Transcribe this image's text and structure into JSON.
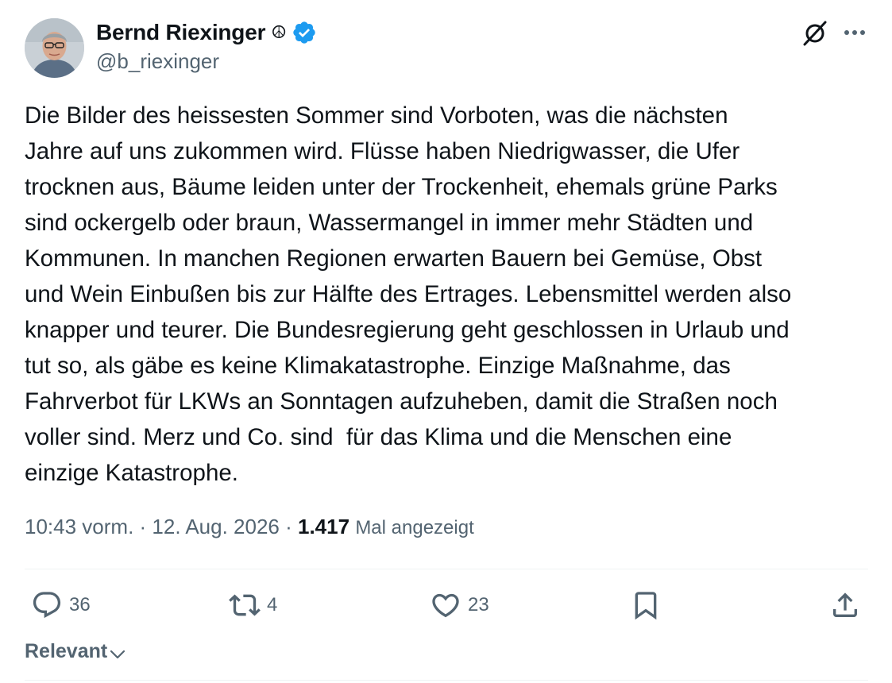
{
  "author": {
    "name": "Bernd Riexinger",
    "name_emoji": "☮",
    "handle": "@b_riexinger",
    "verified_color": "#1d9bf0"
  },
  "tweet": {
    "text": "Die Bilder des heissesten Sommer sind Vorboten, was die nächsten\nJahre auf uns zukommen wird. Flüsse haben Niedrigwasser, die Ufer\ntrocknen aus, Bäume leiden unter der Trockenheit, ehemals grüne Parks\nsind ockergelb oder braun, Wassermangel in immer mehr Städten und\nKommunen. In manchen Regionen erwarten Bauern bei Gemüse, Obst\nund Wein Einbußen bis zur Hälfte des Ertrages. Lebensmittel werden also\nknapper und teurer. Die Bundesregierung geht geschlossen in Urlaub und\ntut so, als gäbe es keine Klimakatastrophe. Einzige Maßnahme, das\nFahrverbot für LKWs an Sonntagen aufzuheben, damit die Straßen noch\nvoller sind. Merz und Co. sind  für das Klima und die Menschen eine\neinzige Katastrophe."
  },
  "meta": {
    "time": "10:43 vorm.",
    "separator": " · ",
    "date": "12. Aug. 2026",
    "views_count": "1.417",
    "views_label": "Mal angezeigt"
  },
  "actions": {
    "replies": "36",
    "reposts": "4",
    "likes": "23"
  },
  "icons": {
    "header": [
      "grok-icon",
      "more-icon"
    ],
    "actions": [
      "reply-icon",
      "repost-icon",
      "like-icon",
      "bookmark-icon",
      "share-icon"
    ]
  },
  "sort": {
    "label": "Relevant"
  }
}
